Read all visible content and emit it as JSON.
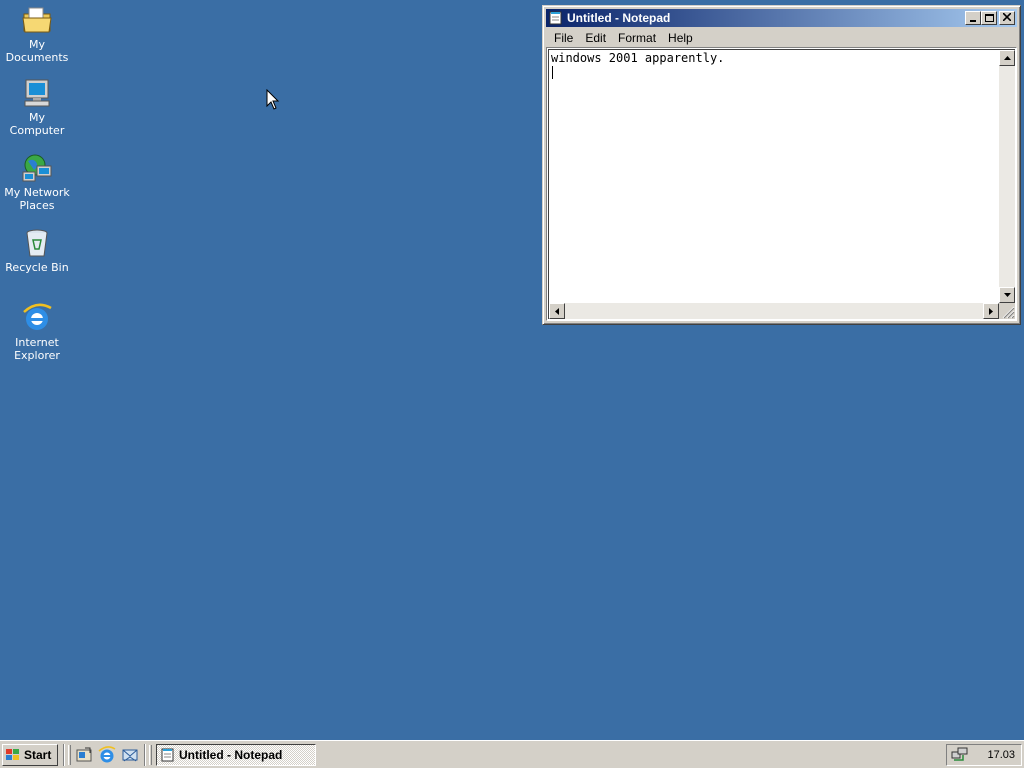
{
  "desktop": {
    "background_color": "#3a6ea5",
    "icons": [
      {
        "label": "My Documents",
        "icon": "folder-documents-icon"
      },
      {
        "label": "My Computer",
        "icon": "computer-icon"
      },
      {
        "label": "My Network Places",
        "icon": "network-icon"
      },
      {
        "label": "Recycle Bin",
        "icon": "recycle-bin-icon"
      },
      {
        "label": "Internet Explorer",
        "icon": "internet-explorer-icon"
      }
    ]
  },
  "notepad": {
    "title": "Untitled - Notepad",
    "menu": [
      "File",
      "Edit",
      "Format",
      "Help"
    ],
    "content": "windows 2001 apparently.",
    "title_buttons": [
      "minimize",
      "maximize",
      "close"
    ]
  },
  "taskbar": {
    "start_label": "Start",
    "quick_launch": [
      "show-desktop-icon",
      "internet-explorer-icon",
      "outlook-express-icon"
    ],
    "tasks": [
      {
        "label": "Untitled - Notepad",
        "active": true
      }
    ],
    "clock": "17.03"
  },
  "colors": {
    "titlebar_start": "#0a246a",
    "titlebar_end": "#a6caf0",
    "face": "#d4d0c8"
  }
}
